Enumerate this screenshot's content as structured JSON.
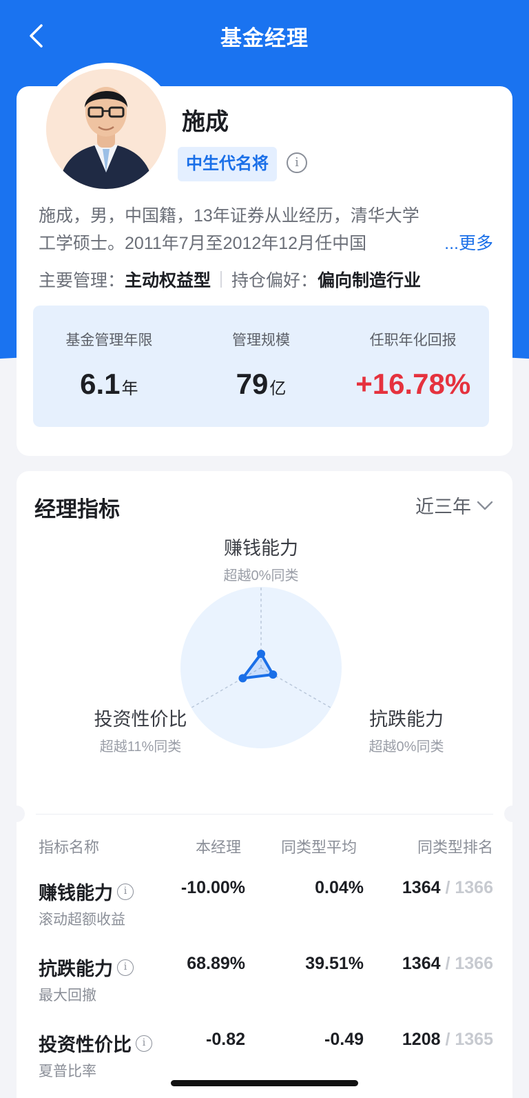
{
  "header": {
    "title": "基金经理"
  },
  "profile": {
    "name": "施成",
    "tag": "中生代名将",
    "bio_line1": "施成，男，中国籍，13年证券从业经历，清华大学",
    "bio_line2": "工学硕士。2011年7月至2012年12月任中国",
    "more": "...更多",
    "main_mgmt_label": "主要管理：",
    "main_mgmt_value": "主动权益型",
    "holding_pref_label": "持仓偏好：",
    "holding_pref_value": "偏向制造行业",
    "stats": [
      {
        "label": "基金管理年限",
        "value": "6.1",
        "unit": "年"
      },
      {
        "label": "管理规模",
        "value": "79",
        "unit": "亿"
      },
      {
        "label": "任职年化回报",
        "value": "+16.78%",
        "unit": ""
      }
    ]
  },
  "metrics": {
    "title": "经理指标",
    "period": "近三年",
    "radar": [
      {
        "name": "赚钱能力",
        "sub": "超越0%同类",
        "percentile": 0
      },
      {
        "name": "抗跌能力",
        "sub": "超越0%同类",
        "percentile": 0
      },
      {
        "name": "投资性价比",
        "sub": "超越11%同类",
        "percentile": 11
      }
    ],
    "table": {
      "headers": [
        "指标名称",
        "本经理",
        "同类型平均",
        "同类型排名"
      ],
      "rows": [
        {
          "name": "赚钱能力",
          "sub": "滚动超额收益",
          "mine": "-10.00%",
          "avg": "0.04%",
          "rank": "1364",
          "total": "/ 1366"
        },
        {
          "name": "抗跌能力",
          "sub": "最大回撤",
          "mine": "68.89%",
          "avg": "39.51%",
          "rank": "1364",
          "total": "/ 1366"
        },
        {
          "name": "投资性价比",
          "sub": "夏普比率",
          "mine": "-0.82",
          "avg": "-0.49",
          "rank": "1208",
          "total": "/ 1365"
        }
      ]
    }
  },
  "colors": {
    "brand": "#1a73f0",
    "positive": "#e5323e",
    "tag_bg": "#e4efff"
  }
}
